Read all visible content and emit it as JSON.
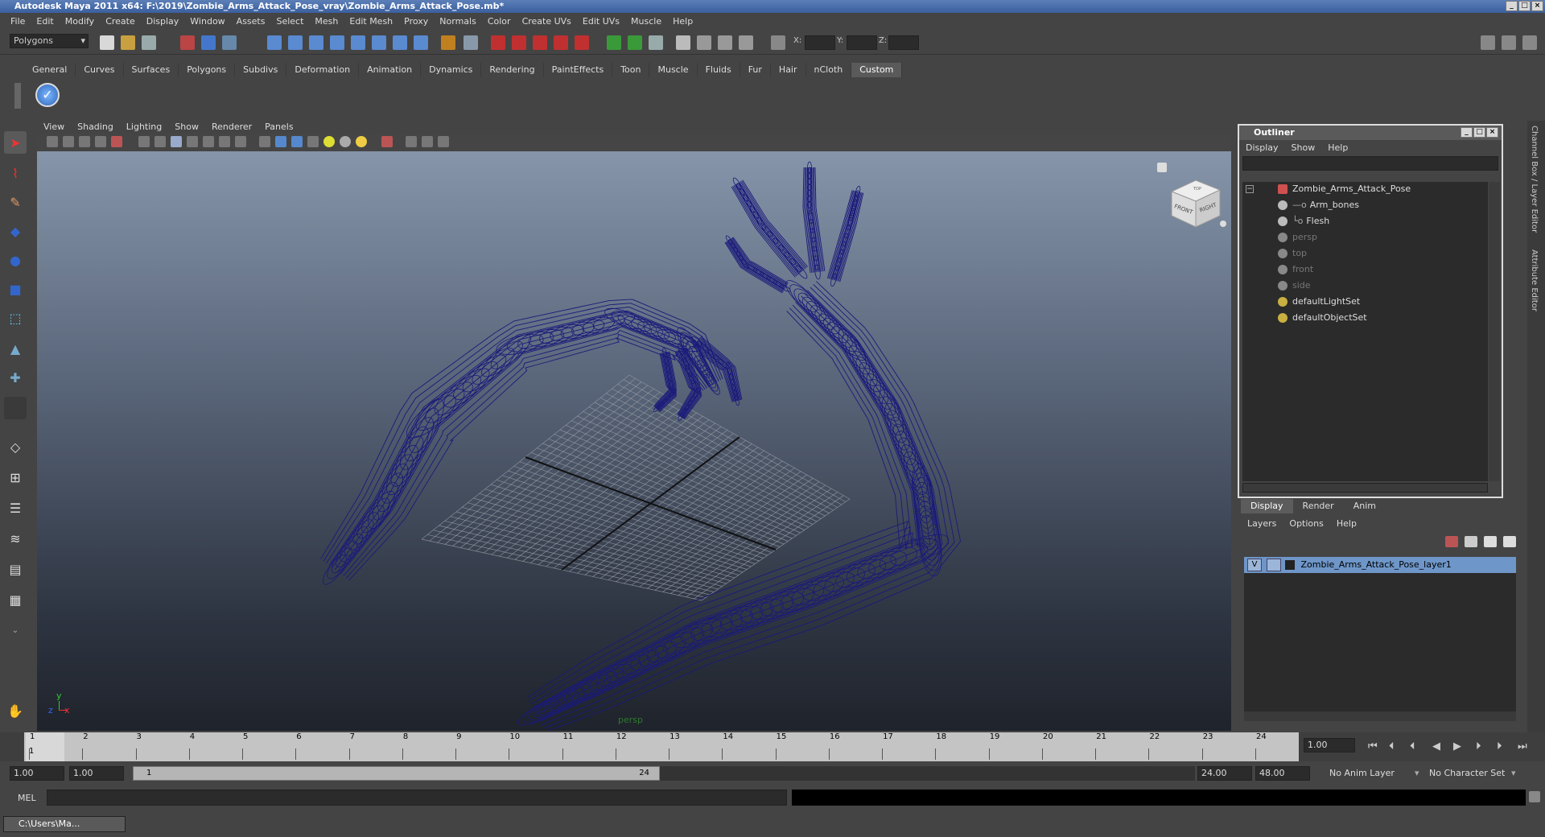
{
  "window": {
    "title": "Autodesk Maya 2011 x64: F:\\2019\\Zombie_Arms_Attack_Pose_vray\\Zombie_Arms_Attack_Pose.mb*"
  },
  "menubar": [
    "File",
    "Edit",
    "Modify",
    "Create",
    "Display",
    "Window",
    "Assets",
    "Select",
    "Mesh",
    "Edit Mesh",
    "Proxy",
    "Normals",
    "Color",
    "Create UVs",
    "Edit UVs",
    "Muscle",
    "Help"
  ],
  "statusline": {
    "menuset": "Polygons",
    "x_label": "X:",
    "y_label": "Y:",
    "z_label": "Z:"
  },
  "shelf_tabs": [
    "General",
    "Curves",
    "Surfaces",
    "Polygons",
    "Subdivs",
    "Deformation",
    "Animation",
    "Dynamics",
    "Rendering",
    "PaintEffects",
    "Toon",
    "Muscle",
    "Fluids",
    "Fur",
    "Hair",
    "nCloth",
    "Custom"
  ],
  "shelf_active": "Custom",
  "viewport": {
    "menu": [
      "View",
      "Shading",
      "Lighting",
      "Show",
      "Renderer",
      "Panels"
    ],
    "camera_label": "persp",
    "viewcube_front": "FRONT",
    "viewcube_right": "RIGHT",
    "viewcube_top": "TOP",
    "axis_x": "x",
    "axis_y": "y",
    "axis_z": "z",
    "wire_color": "#1a1a7a"
  },
  "outliner": {
    "title": "Outliner",
    "menu": [
      "Display",
      "Show",
      "Help"
    ],
    "items": [
      {
        "label": "Zombie_Arms_Attack_Pose",
        "dim": false
      },
      {
        "label": "Arm_bones",
        "dim": false
      },
      {
        "label": "Flesh",
        "dim": false
      },
      {
        "label": "persp",
        "dim": true
      },
      {
        "label": "top",
        "dim": true
      },
      {
        "label": "front",
        "dim": true
      },
      {
        "label": "side",
        "dim": true
      },
      {
        "label": "defaultLightSet",
        "dim": false
      },
      {
        "label": "defaultObjectSet",
        "dim": false
      }
    ]
  },
  "layers": {
    "tabs": [
      "Display",
      "Render",
      "Anim"
    ],
    "menu": [
      "Layers",
      "Options",
      "Help"
    ],
    "row_visible": "V",
    "row_name": "Zombie_Arms_Attack_Pose_layer1",
    "selection_color": "#6e96c8"
  },
  "side_tabs": [
    "Channel Box / Layer Editor",
    "Attribute Editor"
  ],
  "timeline": {
    "ticks": [
      "1",
      "2",
      "3",
      "4",
      "5",
      "6",
      "7",
      "8",
      "9",
      "10",
      "11",
      "12",
      "13",
      "14",
      "15",
      "16",
      "17",
      "18",
      "19",
      "20",
      "21",
      "22",
      "23",
      "24"
    ],
    "current_marker": "1",
    "current_frame": "1.00"
  },
  "range": {
    "start": "1.00",
    "playback_start": "1.00",
    "handle_start": "1",
    "handle_end": "24",
    "playback_end": "24.00",
    "end": "48.00",
    "anim_layer": "No Anim Layer",
    "character_set": "No Character Set"
  },
  "cmdline": {
    "label": "MEL"
  },
  "taskbar": {
    "item": "C:\\Users\\Ma..."
  }
}
